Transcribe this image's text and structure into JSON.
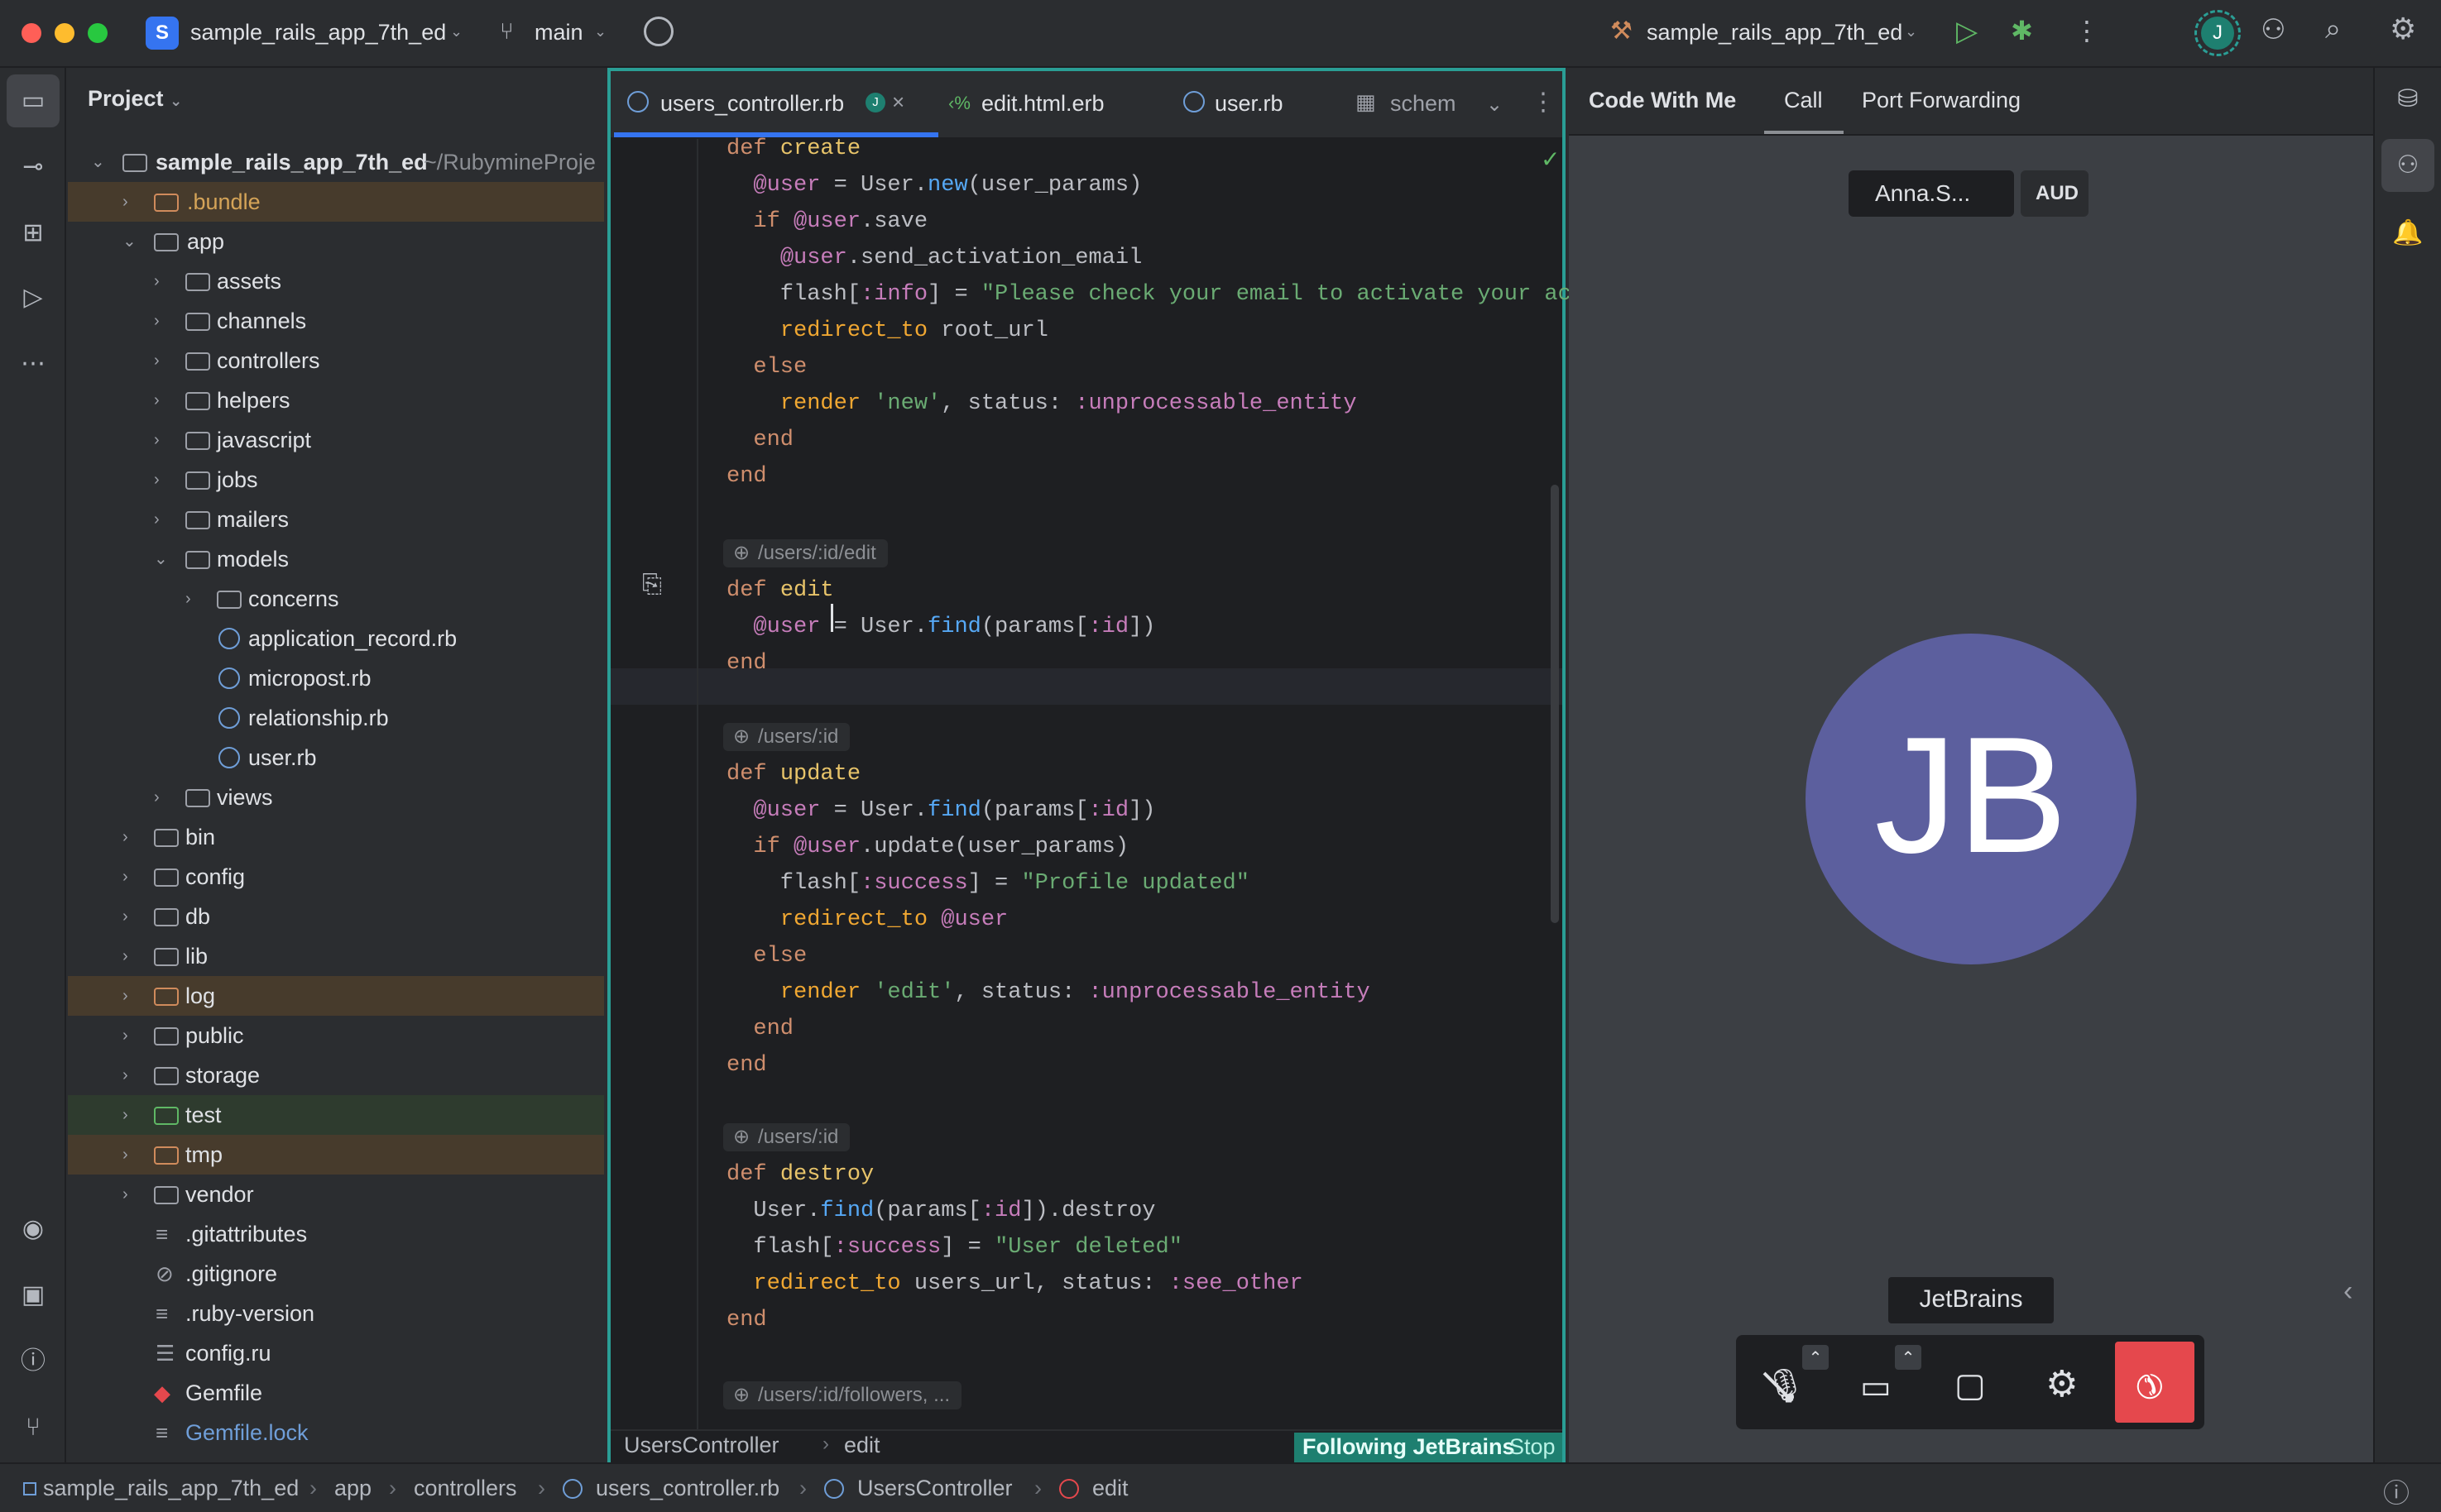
{
  "titlebar": {
    "project_badge": "S",
    "project_name": "sample_rails_app_7th_ed",
    "branch": "main",
    "run_config": "sample_rails_app_7th_ed",
    "avatar": "J"
  },
  "project_panel": {
    "title": "Project",
    "root": "sample_rails_app_7th_ed",
    "root_path": "~/RubymineProje",
    "items": [
      {
        "label": "bundle_prefix",
        "text": ".bundle"
      },
      {
        "text": "app"
      },
      {
        "text": "assets"
      },
      {
        "text": "channels"
      },
      {
        "text": "controllers"
      },
      {
        "text": "helpers"
      },
      {
        "text": "javascript"
      },
      {
        "text": "jobs"
      },
      {
        "text": "mailers"
      },
      {
        "text": "models"
      },
      {
        "text": "concerns"
      },
      {
        "text": "application_record.rb"
      },
      {
        "text": "micropost.rb"
      },
      {
        "text": "relationship.rb"
      },
      {
        "text": "user.rb"
      },
      {
        "text": "views"
      },
      {
        "text": "bin"
      },
      {
        "text": "config"
      },
      {
        "text": "db"
      },
      {
        "text": "lib"
      },
      {
        "text": "log"
      },
      {
        "text": "public"
      },
      {
        "text": "storage"
      },
      {
        "text": "test"
      },
      {
        "text": "tmp"
      },
      {
        "text": "vendor"
      },
      {
        "text": ".gitattributes"
      },
      {
        "text": ".gitignore"
      },
      {
        "text": ".ruby-version"
      },
      {
        "text": "config.ru"
      },
      {
        "text": "Gemfile"
      },
      {
        "text": "Gemfile.lock"
      }
    ]
  },
  "editor": {
    "tabs": [
      {
        "label": "users_controller.rb",
        "badge": "J"
      },
      {
        "label": "edit.html.erb"
      },
      {
        "label": "user.rb"
      },
      {
        "label": "schem"
      }
    ],
    "hints": [
      "/users/:id/edit",
      "/users/:id",
      "/users/:id",
      "/users/:id/followers, ..."
    ],
    "status_left": "UsersController",
    "status_method": "edit",
    "following": "Following JetBrains",
    "stop": "Stop"
  },
  "cwm": {
    "tabs": [
      "Code With Me",
      "Call",
      "Port Forwarding"
    ],
    "participant": "Anna.S...",
    "aud": "AUD",
    "avatar_initials": "JB",
    "speaker_label": "JetBrains",
    "colors": {
      "avatar": "#5c5f9e",
      "hangup": "#e5484d",
      "accent": "#2a9e95"
    }
  },
  "statusbar": {
    "crumbs": [
      "sample_rails_app_7th_ed",
      "app",
      "controllers",
      "users_controller.rb",
      "UsersController",
      "edit"
    ]
  }
}
